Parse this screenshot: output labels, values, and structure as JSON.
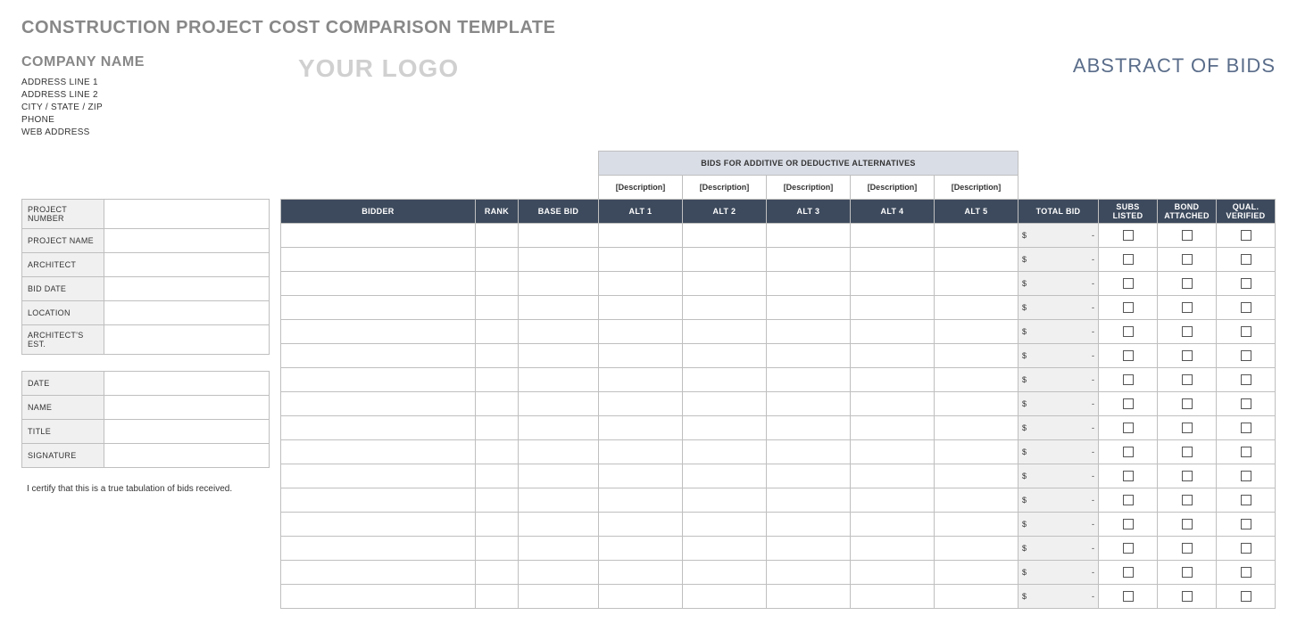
{
  "title": "CONSTRUCTION PROJECT COST COMPARISON TEMPLATE",
  "company": {
    "name": "COMPANY NAME",
    "address1": "ADDRESS LINE 1",
    "address2": "ADDRESS LINE 2",
    "city": "CITY / STATE / ZIP",
    "phone": "PHONE",
    "web": "WEB ADDRESS"
  },
  "logo": "YOUR LOGO",
  "abstract_title": "ABSTRACT OF BIDS",
  "project_info_labels": {
    "number": "PROJECT NUMBER",
    "name": "PROJECT NAME",
    "architect": "ARCHITECT",
    "bid_date": "BID DATE",
    "location": "LOCATION",
    "arch_est": "ARCHITECT'S EST."
  },
  "cert_info_labels": {
    "date": "DATE",
    "name": "NAME",
    "title": "TITLE",
    "signature": "SIGNATURE"
  },
  "cert_text": "I certify that this is a true tabulation of bids received.",
  "table": {
    "alt_header": "BIDS FOR ADDITIVE OR DEDUCTIVE ALTERNATIVES",
    "desc_placeholder": "[Description]",
    "cols": {
      "bidder": "BIDDER",
      "rank": "RANK",
      "base_bid": "BASE BID",
      "alt1": "ALT 1",
      "alt2": "ALT 2",
      "alt3": "ALT 3",
      "alt4": "ALT 4",
      "alt5": "ALT 5",
      "total_bid": "TOTAL BID",
      "subs": "SUBS LISTED",
      "bond": "BOND ATTACHED",
      "qual": "QUAL. VERIFIED"
    },
    "total_currency": "$",
    "total_dash": "-",
    "row_count": 16
  }
}
